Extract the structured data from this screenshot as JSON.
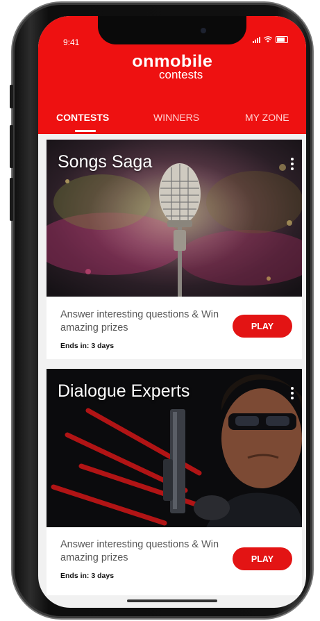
{
  "status_bar": {
    "time": "9:41"
  },
  "brand": {
    "logo_main": "onmobile",
    "logo_sub": "contests",
    "color": "#ee1111"
  },
  "tabs": [
    {
      "label": "CONTESTS",
      "active": true
    },
    {
      "label": "WINNERS",
      "active": false
    },
    {
      "label": "MY ZONE",
      "active": false
    }
  ],
  "contests": [
    {
      "title": "Songs Saga",
      "description": "Answer interesting questions & Win amazing prizes",
      "ends_label": "Ends in:",
      "ends_value": "3 days",
      "play_label": "PLAY",
      "image_icon": "microphone-image"
    },
    {
      "title": "Dialogue Experts",
      "description": "Answer interesting questions & Win amazing prizes",
      "ends_label": "Ends in:",
      "ends_value": "3 days",
      "play_label": "PLAY",
      "image_icon": "action-hero-image"
    }
  ]
}
